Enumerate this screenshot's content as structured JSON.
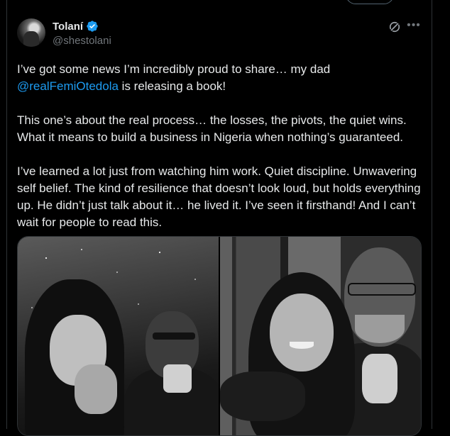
{
  "post": {
    "author": {
      "display_name": "Tolaní",
      "handle": "@shestolani",
      "verified": true
    },
    "icons": {
      "verified": "verified-badge-icon",
      "grok": "grok-icon",
      "more": "more-options-icon"
    },
    "text": {
      "p1_before": "I’ve got some news I’m incredibly proud to share… my dad ",
      "p1_mention": "@realFemiOtedola",
      "p1_after": " is releasing a book!",
      "p2": "This one’s about the real process… the losses, the pivots, the quiet wins. What it means to build a business in Nigeria when nothing’s guaranteed.",
      "p3": "I’ve learned a lot just from watching him work. Quiet discipline. Unwavering self belief. The kind of resilience that doesn’t look loud, but holds everything up. He didn’t just talk about it… he lived it. I’ve seen it firsthand! And I can’t wait for people to read this."
    },
    "media": {
      "count": 2
    }
  },
  "colors": {
    "background": "#000000",
    "text": "#e7e9ea",
    "secondary": "#71767b",
    "link": "#1d9bf0",
    "verified": "#1d9bf0",
    "border": "#2f3336"
  }
}
